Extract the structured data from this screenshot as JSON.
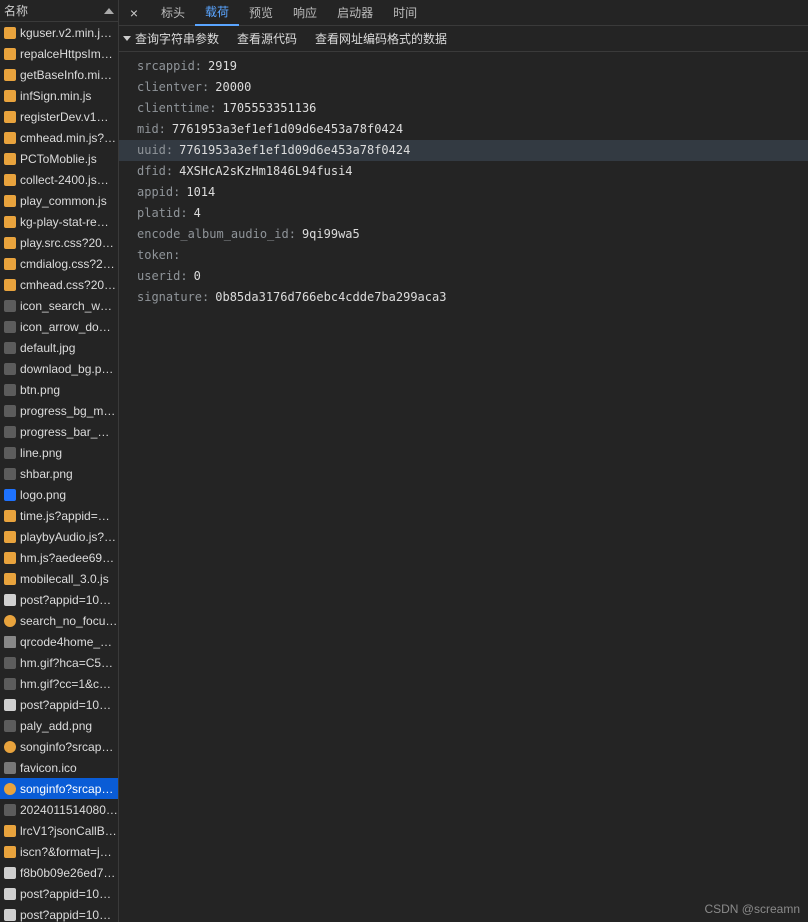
{
  "left": {
    "header": "名称",
    "files": [
      {
        "name": "kguser.v2.min.j…",
        "icon": "js"
      },
      {
        "name": "repalceHttpsIm…",
        "icon": "js"
      },
      {
        "name": "getBaseInfo.mi…",
        "icon": "js"
      },
      {
        "name": "infSign.min.js",
        "icon": "js"
      },
      {
        "name": "registerDev.v1…",
        "icon": "js"
      },
      {
        "name": "cmhead.min.js?…",
        "icon": "js"
      },
      {
        "name": "PCToMoblie.js",
        "icon": "js"
      },
      {
        "name": "collect-2400.js…",
        "icon": "js"
      },
      {
        "name": "play_common.js",
        "icon": "js"
      },
      {
        "name": "kg-play-stat-re…",
        "icon": "js"
      },
      {
        "name": "play.src.css?201…",
        "icon": "css"
      },
      {
        "name": "cmdialog.css?2…",
        "icon": "css"
      },
      {
        "name": "cmhead.css?20…",
        "icon": "css"
      },
      {
        "name": "icon_search_wh…",
        "icon": "img"
      },
      {
        "name": "icon_arrow_do…",
        "icon": "img"
      },
      {
        "name": "default.jpg",
        "icon": "img"
      },
      {
        "name": "downlaod_bg.p…",
        "icon": "img"
      },
      {
        "name": "btn.png",
        "icon": "img"
      },
      {
        "name": "progress_bg_mi…",
        "icon": "img"
      },
      {
        "name": "progress_bar_m…",
        "icon": "img"
      },
      {
        "name": "line.png",
        "icon": "img"
      },
      {
        "name": "shbar.png",
        "icon": "png"
      },
      {
        "name": "logo.png",
        "icon": "logo"
      },
      {
        "name": "time.js?appid=…",
        "icon": "js"
      },
      {
        "name": "playbyAudio.js?…",
        "icon": "js"
      },
      {
        "name": "hm.js?aedee698…",
        "icon": "js"
      },
      {
        "name": "mobilecall_3.0.js",
        "icon": "js"
      },
      {
        "name": "post?appid=10…",
        "icon": "doc"
      },
      {
        "name": "search_no_focu…",
        "icon": "xhr"
      },
      {
        "name": "qrcode4home_…",
        "icon": "qr"
      },
      {
        "name": "hm.gif?hca=C5…",
        "icon": "img"
      },
      {
        "name": "hm.gif?cc=1&c…",
        "icon": "img"
      },
      {
        "name": "post?appid=10…",
        "icon": "doc"
      },
      {
        "name": "paly_add.png",
        "icon": "img"
      },
      {
        "name": "songinfo?srcap…",
        "icon": "xhr"
      },
      {
        "name": "favicon.ico",
        "icon": "other"
      },
      {
        "name": "songinfo?srcap…",
        "icon": "xhr",
        "selected": true
      },
      {
        "name": "2024011514080…",
        "icon": "png"
      },
      {
        "name": "lrcV1?jsonCallB…",
        "icon": "js"
      },
      {
        "name": "iscn?&format=j…",
        "icon": "js"
      },
      {
        "name": "f8b0b09e26ed7…",
        "icon": "doc"
      },
      {
        "name": "post?appid=10…",
        "icon": "doc"
      },
      {
        "name": "post?appid=10…",
        "icon": "doc"
      }
    ]
  },
  "tabs": {
    "close": "×",
    "items": [
      "标头",
      "载荷",
      "预览",
      "响应",
      "启动器",
      "时间"
    ],
    "active_index": 1
  },
  "subheader": {
    "group": "查询字符串参数",
    "view_source": "查看源代码",
    "view_encoded": "查看网址编码格式的数据"
  },
  "payload": [
    {
      "key": "srcappid:",
      "val": "2919"
    },
    {
      "key": "clientver:",
      "val": "20000"
    },
    {
      "key": "clienttime:",
      "val": "1705553351136"
    },
    {
      "key": "mid:",
      "val": "7761953a3ef1ef1d09d6e453a78f0424"
    },
    {
      "key": "uuid:",
      "val": "7761953a3ef1ef1d09d6e453a78f0424",
      "hover": true
    },
    {
      "key": "dfid:",
      "val": "4XSHcA2sKzHm1846L94fusi4"
    },
    {
      "key": "appid:",
      "val": "1014"
    },
    {
      "key": "platid:",
      "val": "4"
    },
    {
      "key": "encode_album_audio_id:",
      "val": "9qi99wa5"
    },
    {
      "key": "token:",
      "val": ""
    },
    {
      "key": "userid:",
      "val": "0"
    },
    {
      "key": "signature:",
      "val": "0b85da3176d766ebc4cdde7ba299aca3"
    }
  ],
  "watermark": "CSDN @screamn"
}
